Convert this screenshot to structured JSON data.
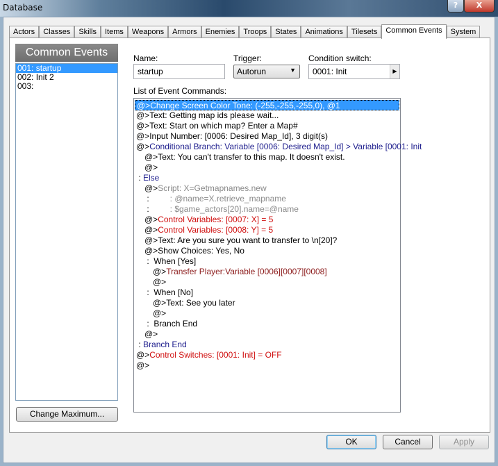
{
  "window": {
    "title": "Database",
    "help_label": "?",
    "close_label": "X"
  },
  "tabs": [
    "Actors",
    "Classes",
    "Skills",
    "Items",
    "Weapons",
    "Armors",
    "Enemies",
    "Troops",
    "States",
    "Animations",
    "Tilesets",
    "Common Events",
    "System"
  ],
  "active_tab": "Common Events",
  "sidebar": {
    "header": "Common Events",
    "items": [
      "001: startup",
      "002: Init 2",
      "003:"
    ],
    "selected": 0,
    "change_max_label": "Change Maximum..."
  },
  "form": {
    "name_label": "Name:",
    "name_value": "startup",
    "trigger_label": "Trigger:",
    "trigger_value": "Autorun",
    "condition_label": "Condition switch:",
    "condition_value": "0001: Init",
    "list_label": "List of Event Commands:"
  },
  "colors": {
    "normal": "#000000",
    "branch": "#1c1c8c",
    "script": "#8a8a8a",
    "red": "#d01010",
    "darkred": "#8b1a1a",
    "selection": "#3399ff"
  },
  "commands": [
    {
      "i": 0,
      "p": "@>",
      "t": "Change Screen Color Tone: (-255,-255,-255,0), @1",
      "c": "normal",
      "sel": true
    },
    {
      "i": 0,
      "p": "@>",
      "t": "Text: Getting map ids please wait...",
      "c": "normal"
    },
    {
      "i": 0,
      "p": "@>",
      "t": "Text: Start on which map? Enter a Map#",
      "c": "normal"
    },
    {
      "i": 0,
      "p": "@>",
      "t": "Input Number: [0006: Desired Map_Id], 3 digit(s)",
      "c": "normal"
    },
    {
      "i": 0,
      "p": "@>",
      "t": "Conditional Branch: Variable [0006: Desired Map_Id] > Variable [0001: Init",
      "c": "branch"
    },
    {
      "i": 1,
      "p": "@>",
      "t": "Text: You can't transfer to this map. It doesn't exist.",
      "c": "normal"
    },
    {
      "i": 1,
      "p": "@>",
      "t": "",
      "c": "normal"
    },
    {
      "i": 0,
      "p": " : ",
      "t": "Else",
      "c": "branch"
    },
    {
      "i": 1,
      "p": "@>",
      "t": "Script: X=Getmapnames.new",
      "c": "script"
    },
    {
      "i": 1,
      "p": " :",
      "t": "         : @name=X.retrieve_mapname",
      "c": "script"
    },
    {
      "i": 1,
      "p": " :",
      "t": "         : $game_actors[20].name=@name",
      "c": "script"
    },
    {
      "i": 1,
      "p": "@>",
      "t": "Control Variables: [0007: X] = 5",
      "c": "red"
    },
    {
      "i": 1,
      "p": "@>",
      "t": "Control Variables: [0008: Y] = 5",
      "c": "red"
    },
    {
      "i": 1,
      "p": "@>",
      "t": "Text: Are you sure you want to transfer to \\n[20]?",
      "c": "normal"
    },
    {
      "i": 1,
      "p": "@>",
      "t": "Show Choices: Yes, No",
      "c": "normal"
    },
    {
      "i": 1,
      "p": " :  ",
      "t": "When [Yes]",
      "c": "normal"
    },
    {
      "i": 2,
      "p": "@>",
      "t": "Transfer Player:Variable [0006][0007][0008]",
      "c": "darkred"
    },
    {
      "i": 2,
      "p": "@>",
      "t": "",
      "c": "normal"
    },
    {
      "i": 1,
      "p": " :  ",
      "t": "When [No]",
      "c": "normal"
    },
    {
      "i": 2,
      "p": "@>",
      "t": "Text: See you later",
      "c": "normal"
    },
    {
      "i": 2,
      "p": "@>",
      "t": "",
      "c": "normal"
    },
    {
      "i": 1,
      "p": " :  ",
      "t": "Branch End",
      "c": "normal"
    },
    {
      "i": 1,
      "p": "@>",
      "t": "",
      "c": "normal"
    },
    {
      "i": 0,
      "p": " : ",
      "t": "Branch End",
      "c": "branch"
    },
    {
      "i": 0,
      "p": "@>",
      "t": "Control Switches: [0001: Init] = OFF",
      "c": "red"
    },
    {
      "i": 0,
      "p": "@>",
      "t": "",
      "c": "normal"
    }
  ],
  "buttons": {
    "ok": "OK",
    "cancel": "Cancel",
    "apply": "Apply"
  }
}
